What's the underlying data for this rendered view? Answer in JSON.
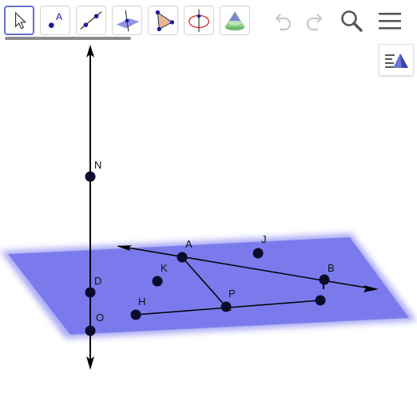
{
  "toolbar": {
    "tools": [
      {
        "name": "move-tool-icon",
        "active": true
      },
      {
        "name": "point-tool-icon",
        "glyph": "A"
      },
      {
        "name": "line-tool-icon"
      },
      {
        "name": "plane-tool-icon"
      },
      {
        "name": "polygon-tool-icon"
      },
      {
        "name": "circle-axis-tool-icon"
      },
      {
        "name": "cone-solid-tool-icon"
      }
    ],
    "actions": [
      "undo-icon",
      "redo-icon",
      "search-icon",
      "menu-icon"
    ]
  },
  "colors": {
    "accent": "#6a6fd0",
    "plane": "#6666ee",
    "point": "#0b0b2e",
    "line": "#000000"
  },
  "points": [
    {
      "label": "N"
    },
    {
      "label": "D"
    },
    {
      "label": "O"
    },
    {
      "label": "A"
    },
    {
      "label": "J"
    },
    {
      "label": "K"
    },
    {
      "label": "B"
    },
    {
      "label": "P"
    },
    {
      "label": "H"
    }
  ],
  "style_bar": {
    "icon": "graphics-style-icon"
  }
}
